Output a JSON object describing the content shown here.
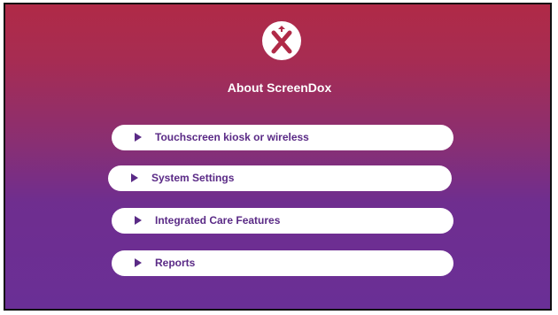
{
  "app": {
    "logo_icon": "screendox-x-logo-icon",
    "title": "About ScreenDox"
  },
  "menu": {
    "items": [
      {
        "label": "Touchscreen kiosk or wireless",
        "icon": "triangle-right-icon"
      },
      {
        "label": "System Settings",
        "icon": "triangle-right-icon"
      },
      {
        "label": "Integrated Care Features",
        "icon": "triangle-right-icon"
      },
      {
        "label": "Reports",
        "icon": "triangle-right-icon"
      }
    ]
  },
  "colors": {
    "background_top": "#b02a47",
    "background_bottom": "#6a2f96",
    "button_bg": "#ffffff",
    "button_text": "#5a2a86",
    "title_text": "#ffffff"
  }
}
